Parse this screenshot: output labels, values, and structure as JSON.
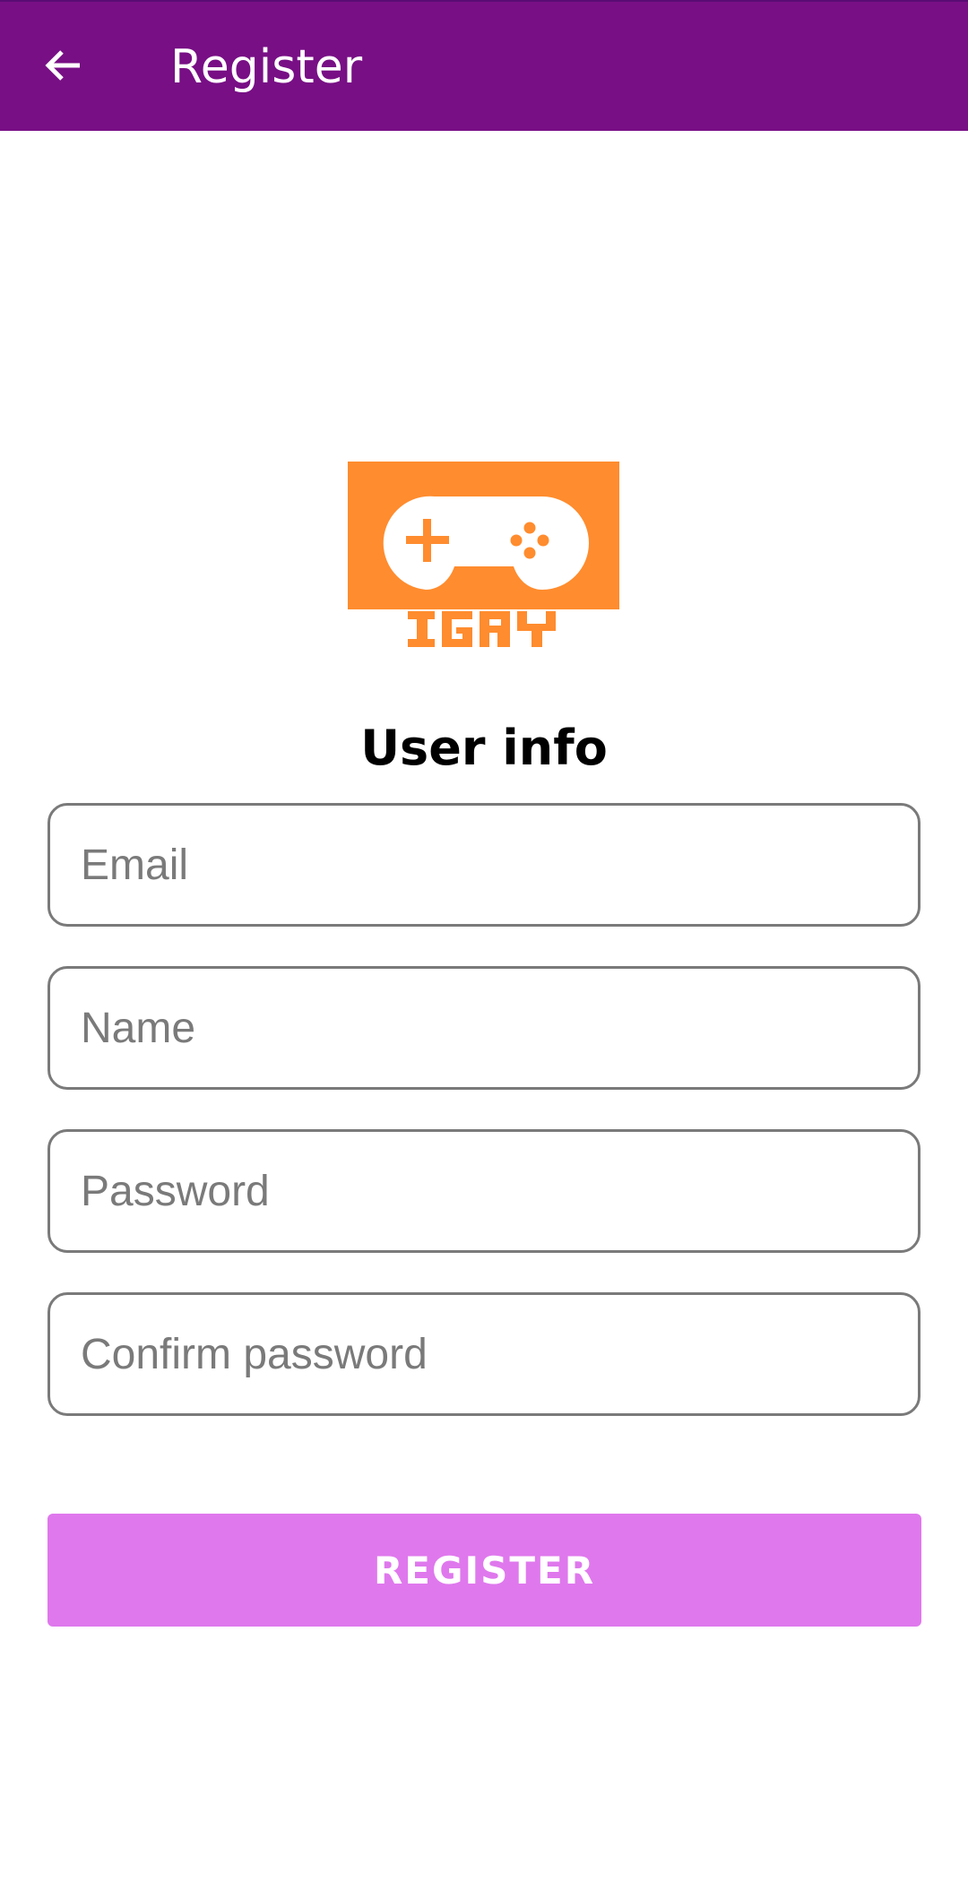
{
  "app_bar": {
    "title": "Register",
    "back_icon": "arrow-left-icon",
    "color": "#780f85"
  },
  "logo": {
    "text": "IGRY",
    "icon": "gamepad-icon",
    "color": "#ff8c2e"
  },
  "form": {
    "title": "User info",
    "fields": [
      {
        "placeholder": "Email",
        "value": ""
      },
      {
        "placeholder": "Name",
        "value": ""
      },
      {
        "placeholder": "Password",
        "value": ""
      },
      {
        "placeholder": "Confirm password",
        "value": ""
      }
    ],
    "submit_label": "REGISTER",
    "submit_color": "#df78ed"
  }
}
